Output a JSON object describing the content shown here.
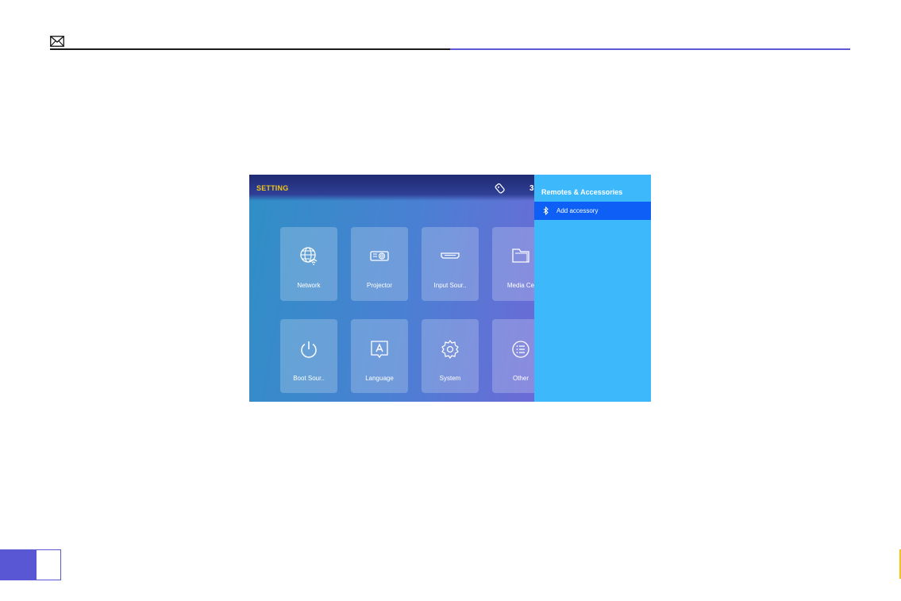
{
  "screen": {
    "title": "SETTING",
    "clock": "3",
    "tiles": [
      {
        "label": "Network",
        "icon": "globe-wifi-icon"
      },
      {
        "label": "Projector",
        "icon": "projector-icon"
      },
      {
        "label": "Input Sour..",
        "icon": "hdmi-icon"
      },
      {
        "label": "Media Ce",
        "icon": "folder-icon"
      },
      {
        "label": "Boot Sour..",
        "icon": "power-icon"
      },
      {
        "label": "Language",
        "icon": "language-icon"
      },
      {
        "label": "System",
        "icon": "gear-icon"
      },
      {
        "label": "Other",
        "icon": "list-icon"
      }
    ]
  },
  "panel": {
    "title": "Remotes & Accessories",
    "items": [
      {
        "label": "Add accessory",
        "icon": "bluetooth-icon"
      }
    ]
  },
  "colors": {
    "accent_blue": "#5b59d6",
    "panel_blue": "#3db8fb",
    "selected_item": "#0d5ff5",
    "title_yellow": "#f0c419"
  }
}
